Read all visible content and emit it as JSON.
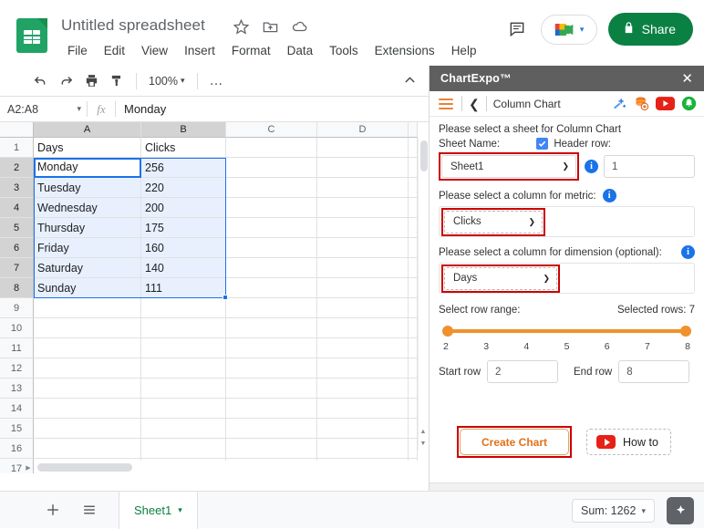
{
  "header": {
    "doc_title": "Untitled spreadsheet",
    "title_icons": [
      "star-icon",
      "move-to-folder-icon",
      "cloud-saved-icon"
    ],
    "menus": [
      "File",
      "Edit",
      "View",
      "Insert",
      "Format",
      "Data",
      "Tools",
      "Extensions",
      "Help"
    ],
    "comment_icon": "comment-icon",
    "meet_label": "meet-camera-icon",
    "share_label": "Share",
    "share_color": "#0b8043"
  },
  "toolbar": {
    "undo": "undo-icon",
    "redo": "redo-icon",
    "print": "print-icon",
    "paint": "paint-format-icon",
    "zoom_value": "100%",
    "more": "…",
    "collapse": "collapse-toolbar-icon"
  },
  "formula_bar": {
    "name_box": "A2:A8",
    "fx": "fx",
    "value": "Monday"
  },
  "grid": {
    "columns": [
      "A",
      "B",
      "C",
      "D"
    ],
    "selected_columns": [
      "A",
      "B"
    ],
    "rows": [
      "1",
      "2",
      "3",
      "4",
      "5",
      "6",
      "7",
      "8",
      "9",
      "10",
      "11",
      "12",
      "13",
      "14",
      "15",
      "16",
      "17"
    ],
    "selected_rows": [
      "2",
      "3",
      "4",
      "5",
      "6",
      "7",
      "8"
    ],
    "data": [
      {
        "row": "1",
        "a": "Days",
        "b": "Clicks"
      },
      {
        "row": "2",
        "a": "Monday",
        "b": "256"
      },
      {
        "row": "3",
        "a": "Tuesday",
        "b": "220"
      },
      {
        "row": "4",
        "a": "Wednesday",
        "b": "200"
      },
      {
        "row": "5",
        "a": "Thursday",
        "b": "175"
      },
      {
        "row": "6",
        "a": "Friday",
        "b": "160"
      },
      {
        "row": "7",
        "a": "Saturday",
        "b": "140"
      },
      {
        "row": "8",
        "a": "Sunday",
        "b": "111"
      }
    ],
    "active_cell_value": "Monday",
    "selection_color": "#1a73e8"
  },
  "bottom_bar": {
    "add_sheet": "add-sheet-icon",
    "all_sheets": "all-sheets-icon",
    "sheet_tab": "Sheet1",
    "sum_label": "Sum: 1262",
    "explore": "explore-icon"
  },
  "chartexpo": {
    "title": "ChartExpo™",
    "close": "✕",
    "titlebar_color": "#5f5f5f",
    "accent_color": "#f0912d",
    "chart_name": "Column Chart",
    "toolbar_icons": [
      "magic-wand-icon",
      "add-data-icon",
      "youtube-icon",
      "notification-bell-icon"
    ],
    "sheet_prompt": "Please select a sheet for Column Chart",
    "sheet_name_label": "Sheet Name:",
    "sheet_name_value": "Sheet1",
    "header_row_label": "Header row:",
    "header_row_value": "1",
    "header_row_checked": true,
    "metric_prompt": "Please select a column for metric:",
    "metric_value": "Clicks",
    "dimension_prompt": "Please select a column for dimension (optional):",
    "dimension_value": "Days",
    "row_range_label": "Select row range:",
    "selected_rows_label": "Selected rows: 7",
    "ticks": [
      "2",
      "3",
      "4",
      "5",
      "6",
      "7",
      "8"
    ],
    "start_row_label": "Start row",
    "start_row_value": "2",
    "end_row_label": "End row",
    "end_row_value": "8",
    "create_chart_label": "Create Chart",
    "how_to_label": "How to"
  }
}
